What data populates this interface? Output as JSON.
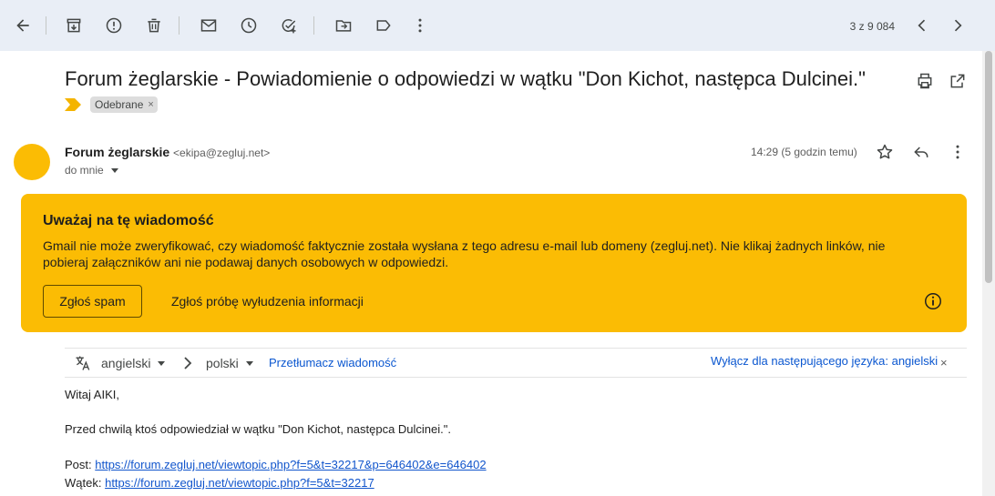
{
  "toolbar": {
    "back_icon": "arrow-left-icon",
    "archive_icon": "archive-icon",
    "report_icon": "report-spam-icon",
    "delete_icon": "trash-icon",
    "mark_unread_icon": "envelope-icon",
    "snooze_icon": "clock-icon",
    "add_task_icon": "add-task-icon",
    "move_icon": "folder-move-icon",
    "label_icon": "label-icon",
    "more_icon": "more-vertical-icon",
    "counter": "3 z 9 084",
    "prev_icon": "chevron-left-icon",
    "next_icon": "chevron-right-icon"
  },
  "email": {
    "subject": "Forum żeglarskie - Powiadomienie o odpowiedzi w wątku \"Don Kichot, następca Dulcinei.\"",
    "label": "Odebrane",
    "label_close": "×",
    "sender_name": "Forum żeglarskie",
    "sender_email": "<ekipa@zegluj.net>",
    "to": "do mnie",
    "time": "14:29 (5 godzin temu)"
  },
  "warning": {
    "title": "Uważaj na tę wiadomość",
    "body": "Gmail nie może zweryfikować, czy wiadomość faktycznie została wysłana z tego adresu e-mail lub domeny (zegluj.net). Nie klikaj żadnych linków, nie pobieraj załączników ani nie podawaj danych osobowych w odpowiedzi.",
    "spam_button": "Zgłoś spam",
    "phishing_button": "Zgłoś próbę wyłudzenia informacji",
    "color": "#fbbc04"
  },
  "translate": {
    "source_lang": "angielski",
    "target_lang": "polski",
    "translate_link": "Przetłumacz wiadomość",
    "disable_link": "Wyłącz dla następującego języka: angielski",
    "close": "×"
  },
  "body": {
    "greeting": "Witaj AIKI,",
    "line1": "Przed chwilą ktoś odpowiedział w wątku \"Don Kichot, następca Dulcinei.\".",
    "post_label": "Post:",
    "post_url": "https://forum.zegluj.net/viewtopic.php?f=5&t=32217&p=646402&e=646402",
    "thread_label": "Wątek:",
    "thread_url": "https://forum.zegluj.net/viewtopic.php?f=5&t=32217"
  }
}
